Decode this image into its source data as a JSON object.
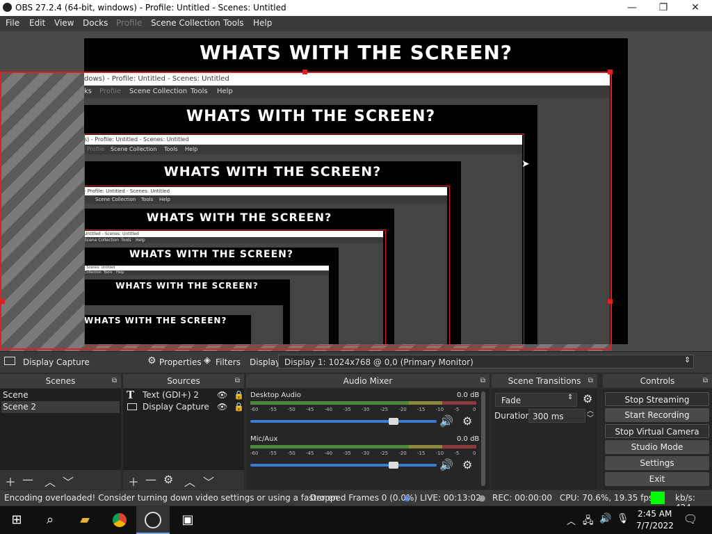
{
  "window": {
    "title": "OBS 27.2.4 (64-bit, windows) - Profile: Untitled - Scenes: Untitled",
    "minimize": "—",
    "maximize": "❐",
    "close": "✕"
  },
  "menu": [
    "File",
    "Edit",
    "View",
    "Docks",
    "Profile",
    "Scene Collection",
    "Tools",
    "Help"
  ],
  "preview": {
    "banner": "WHATS WITH THE SCREEN?",
    "nested_title_1": "dows) - Profile: Untitled - Scenes: Untitled",
    "nested_menu_1": [
      "ks",
      "Profile",
      "Scene Collection",
      "Tools",
      "Help"
    ],
    "nested_title_2": "s) - Profile: Untitled - Scenes: Untitled",
    "nested_menu_2": [
      "Profile",
      "Scene Collection",
      "Tools",
      "Help"
    ],
    "nested_title_3": "- Profile: Untitled - Scenes: Untitled",
    "nested_menu_3": [
      "Scene Collection",
      "Tools",
      "Help"
    ],
    "nested_title_4": "Untitled - Scenes: Untitled",
    "nested_menu_4": [
      "Scene Collection",
      "Tools",
      "Help"
    ],
    "nested_title_5": "- Scenes: Untitled",
    "nested_menu_5": [
      "Collection",
      "Tools",
      "Help"
    ]
  },
  "source_toolbar": {
    "source_name": "Display Capture",
    "properties": "Properties",
    "filters": "Filters",
    "display_label": "Display",
    "display_value": "Display 1: 1024x768 @ 0,0 (Primary Monitor)"
  },
  "scenes": {
    "title": "Scenes",
    "items": [
      "Scene",
      "Scene 2"
    ]
  },
  "sources": {
    "title": "Sources",
    "items": [
      {
        "name": "Text (GDI+) 2",
        "icon": "text-icon"
      },
      {
        "name": "Display Capture",
        "icon": "monitor-icon"
      }
    ]
  },
  "mixer": {
    "title": "Audio Mixer",
    "channels": [
      {
        "name": "Desktop Audio",
        "level": "0.0 dB",
        "volume": 0.8
      },
      {
        "name": "Mic/Aux",
        "level": "0.0 dB",
        "volume": 0.8
      }
    ],
    "scale": [
      "-60",
      "-55",
      "-50",
      "-45",
      "-40",
      "-35",
      "-30",
      "-25",
      "-20",
      "-15",
      "-10",
      "-5",
      "0"
    ]
  },
  "transitions": {
    "title": "Scene Transitions",
    "transition": "Fade",
    "duration_label": "Duration",
    "duration_value": "300 ms"
  },
  "controls": {
    "title": "Controls",
    "buttons": [
      "Stop Streaming",
      "Start Recording",
      "Stop Virtual Camera",
      "Studio Mode",
      "Settings",
      "Exit"
    ]
  },
  "status": {
    "message": "Encoding overloaded! Consider turning down video settings or using a faster en",
    "dropped": "Dropped Frames 0 (0.0%)",
    "live": "LIVE: 00:13:02",
    "rec": "REC: 00:00:00",
    "cpu": "CPU: 70.6%, 19.35 fps",
    "kbs": "kb/s: 424",
    "kbs_color": "#00ff00"
  },
  "taskbar": {
    "time": "2:45 AM",
    "date": "7/7/2022"
  },
  "colors": {
    "selection_red": "#e02020",
    "accent_blue": "#3a7bd5"
  }
}
